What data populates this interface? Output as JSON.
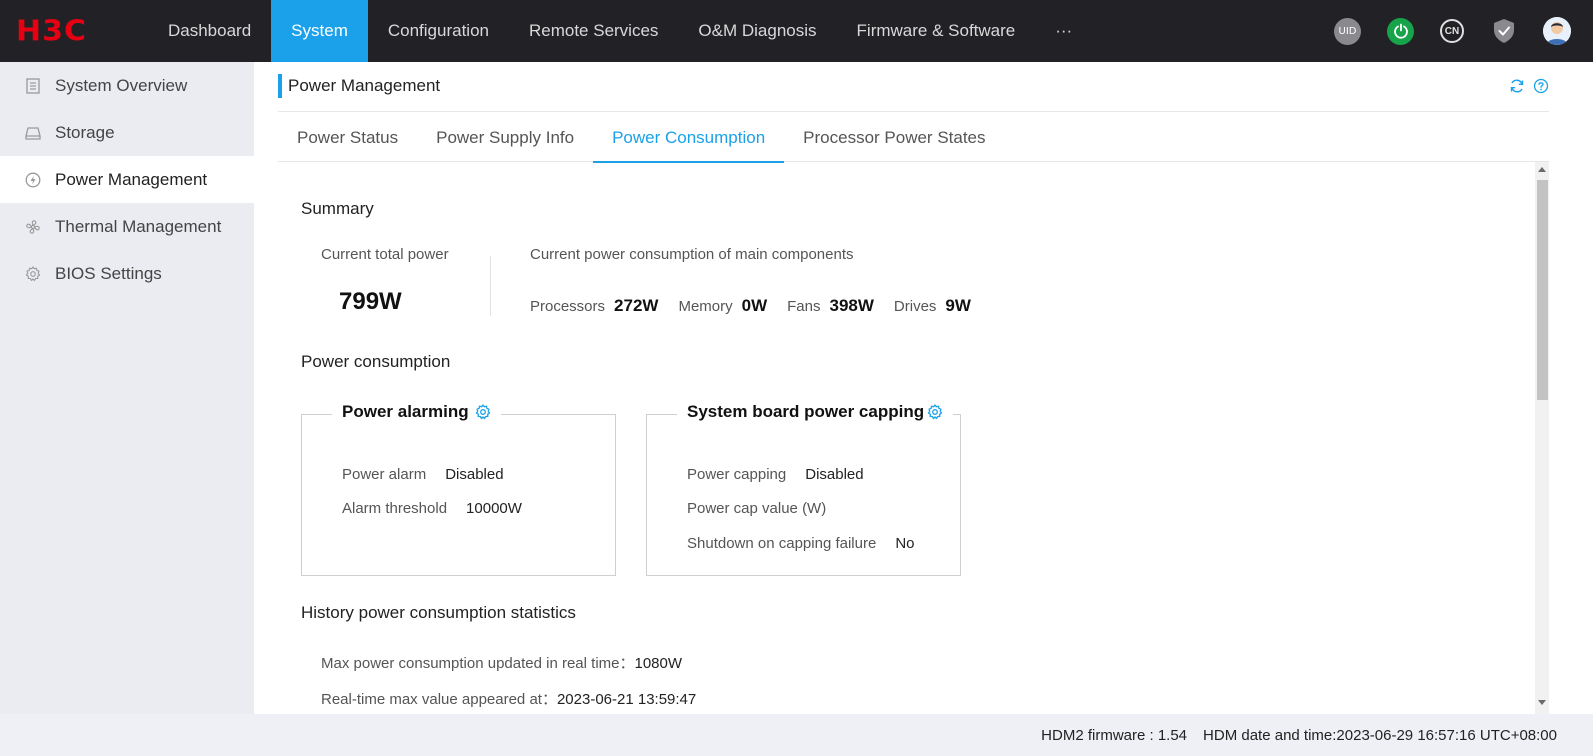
{
  "brand": {
    "logo_text": "H3C",
    "logo_color": "#e60012"
  },
  "nav": {
    "items": [
      {
        "label": "Dashboard"
      },
      {
        "label": "System"
      },
      {
        "label": "Configuration"
      },
      {
        "label": "Remote Services"
      },
      {
        "label": "O&M Diagnosis"
      },
      {
        "label": "Firmware & Software"
      },
      {
        "label": "···"
      }
    ],
    "active": "System",
    "accent": "#1aa1ea"
  },
  "top_icons": {
    "uid_label": "UID",
    "lang_label": "CN",
    "icons": [
      "uid-icon",
      "power-icon",
      "language-icon",
      "shield-icon",
      "user-avatar-icon"
    ]
  },
  "sidebar": {
    "items": [
      {
        "label": "System Overview",
        "icon": "document-icon"
      },
      {
        "label": "Storage",
        "icon": "drive-icon"
      },
      {
        "label": "Power Management",
        "icon": "power-bolt-icon"
      },
      {
        "label": "Thermal Management",
        "icon": "fan-icon"
      },
      {
        "label": "BIOS Settings",
        "icon": "gear-icon"
      }
    ],
    "active": "Power Management"
  },
  "page": {
    "title": "Power Management",
    "tabs": [
      {
        "label": "Power Status"
      },
      {
        "label": "Power Supply Info"
      },
      {
        "label": "Power Consumption"
      },
      {
        "label": "Processor Power States"
      }
    ],
    "active_tab": "Power Consumption"
  },
  "summary": {
    "title": "Summary",
    "total_label": "Current total power",
    "total_value": "799W",
    "components_label": "Current power consumption of main components",
    "components": [
      {
        "name": "Processors",
        "value": "272W"
      },
      {
        "name": "Memory",
        "value": "0W"
      },
      {
        "name": "Fans",
        "value": "398W"
      },
      {
        "name": "Drives",
        "value": "9W"
      }
    ]
  },
  "power_consumption": {
    "title": "Power consumption",
    "alarming": {
      "title": "Power alarming",
      "power_alarm_label": "Power alarm",
      "power_alarm_value": "Disabled",
      "threshold_label": "Alarm threshold",
      "threshold_value": "10000W"
    },
    "capping": {
      "title": "System board power capping",
      "capping_label": "Power capping",
      "capping_value": "Disabled",
      "cap_value_label": "Power cap value (W)",
      "cap_value_value": "",
      "shutdown_label": "Shutdown on capping failure",
      "shutdown_value": "No"
    }
  },
  "history": {
    "title": "History power consumption statistics",
    "max_label": "Max power consumption updated in real time：",
    "max_value": "1080W",
    "max_time_label": "Real-time max value appeared at：",
    "max_time_value": "2023-06-21 13:59:47"
  },
  "footer": {
    "firmware": "HDM2 firmware : 1.54",
    "datetime": "HDM date and time:2023-06-29 16:57:16 UTC+08:00"
  }
}
